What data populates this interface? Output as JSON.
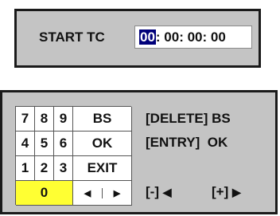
{
  "start_tc": {
    "label": "START TC",
    "cursor_digits": "00",
    "rest": ": 00: 00: 00"
  },
  "keypad": {
    "rows": [
      [
        "7",
        "8",
        "9",
        "BS"
      ],
      [
        "4",
        "5",
        "6",
        "OK"
      ],
      [
        "1",
        "2",
        "3",
        "EXIT"
      ]
    ],
    "zero": "0",
    "left_arrow": "◀",
    "right_arrow": "▶"
  },
  "help": {
    "delete_label": "[DELETE] BS",
    "entry_label": "[ENTRY]  OK",
    "minus_label": "[-]",
    "minus_icon": "◀",
    "plus_label": "[+]",
    "plus_icon": "▶"
  },
  "colors": {
    "panel_bg": "#c4c4c4",
    "cursor_bg": "#00007a",
    "zero_key_bg": "#ffff33"
  }
}
